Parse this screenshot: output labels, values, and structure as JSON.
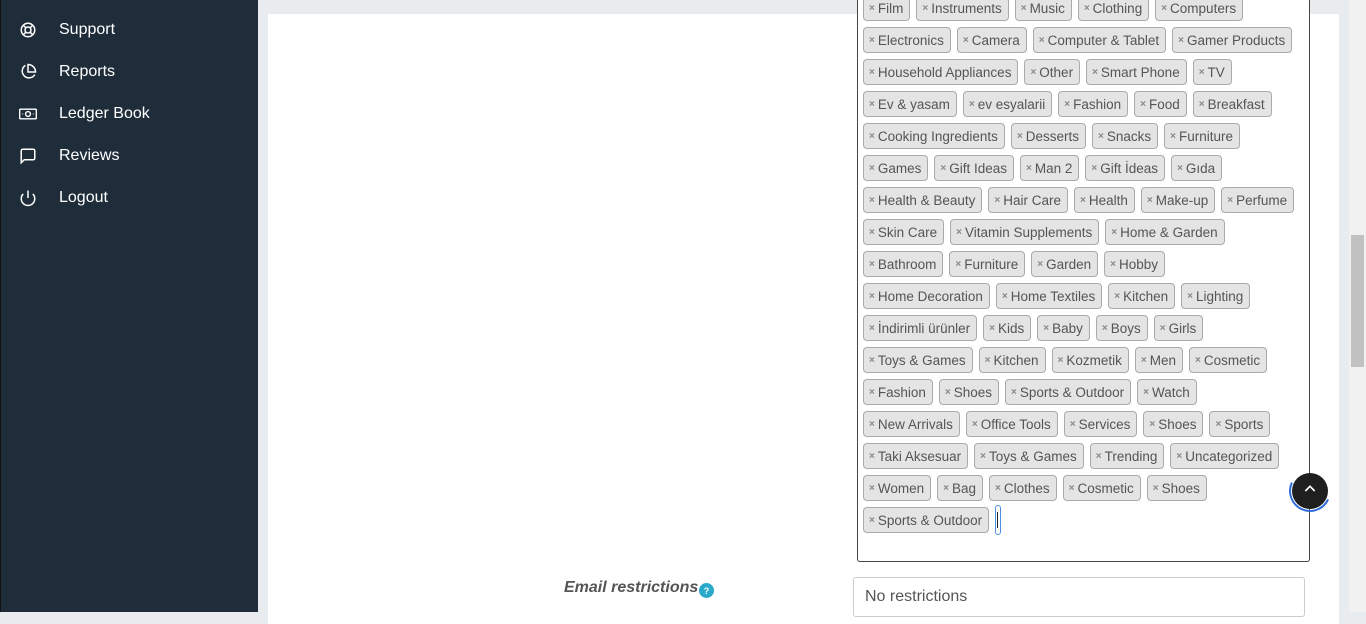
{
  "sidebar": {
    "items": [
      {
        "label": "Support",
        "icon": "lifebuoy-icon"
      },
      {
        "label": "Reports",
        "icon": "pie-chart-icon"
      },
      {
        "label": "Ledger Book",
        "icon": "banknote-icon"
      },
      {
        "label": "Reviews",
        "icon": "message-square-icon"
      },
      {
        "label": "Logout",
        "icon": "power-icon"
      }
    ]
  },
  "categories": {
    "tags": [
      "Film",
      "Instruments",
      "Music",
      "Clothing",
      "Computers",
      "Electronics",
      "Camera",
      "Computer & Tablet",
      "Gamer Products",
      "Household Appliances",
      "Other",
      "Smart Phone",
      "TV",
      "Ev & yasam",
      "ev esyalarii",
      "Fashion",
      "Food",
      "Breakfast",
      "Cooking Ingredients",
      "Desserts",
      "Snacks",
      "Furniture",
      "Games",
      "Gift Ideas",
      "Man 2",
      "Gift İdeas",
      "Gıda",
      "Health & Beauty",
      "Hair Care",
      "Health",
      "Make-up",
      "Perfume",
      "Skin Care",
      "Vitamin Supplements",
      "Home & Garden",
      "Bathroom",
      "Furniture",
      "Garden",
      "Hobby",
      "Home Decoration",
      "Home Textiles",
      "Kitchen",
      "Lighting",
      "İndirimli ürünler",
      "Kids",
      "Baby",
      "Boys",
      "Girls",
      "Toys & Games",
      "Kitchen",
      "Kozmetik",
      "Men",
      "Cosmetic",
      "Fashion",
      "Shoes",
      "Sports & Outdoor",
      "Watch",
      "New Arrivals",
      "Office Tools",
      "Services",
      "Shoes",
      "Sports",
      "Taki Aksesuar",
      "Toys & Games",
      "Trending",
      "Uncategorized",
      "Women",
      "Bag",
      "Clothes",
      "Cosmetic",
      "Shoes",
      "Sports & Outdoor"
    ],
    "remove_glyph": "×"
  },
  "email_restrictions": {
    "label": "Email restrictions",
    "help_glyph": "?",
    "placeholder": "No restrictions"
  },
  "colors": {
    "sidebar_bg": "#1f2d3a",
    "tag_bg": "#e4e4e4",
    "accent": "#2ba9c8",
    "back_to_top_bg": "#1f1f1f"
  }
}
